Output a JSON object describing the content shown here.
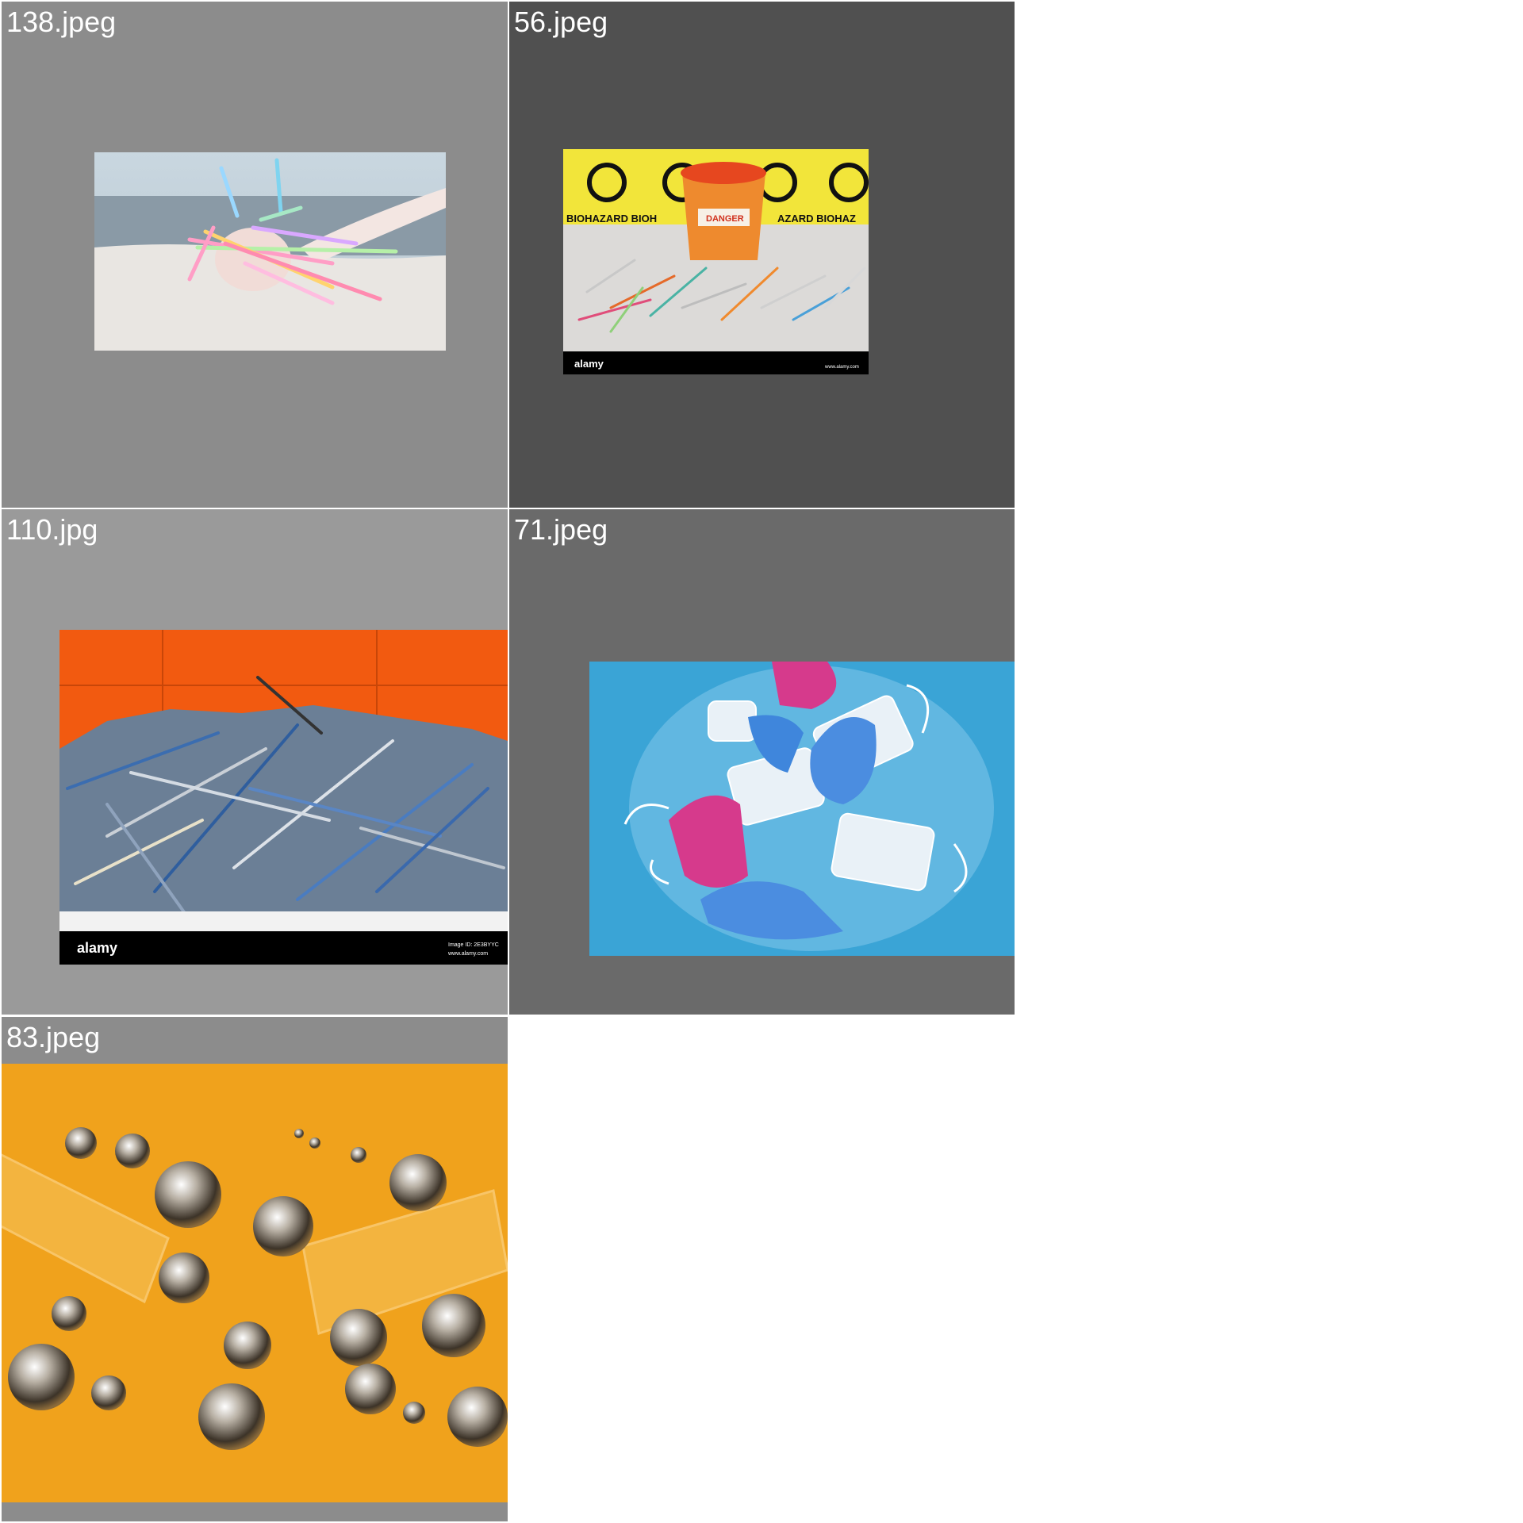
{
  "gallery": {
    "tiles": [
      {
        "filename": "138.jpeg",
        "subject": "hand holding plastic straws at beach",
        "background": "#8c8c8c"
      },
      {
        "filename": "56.jpeg",
        "subject": "biohazard sharps container with syringes",
        "background": "#505050",
        "overlay_text": [
          "BIOHAZARD BIOH",
          "AZARD BIOHAZ",
          "DANGER",
          "alamy",
          "www.alamy.com"
        ]
      },
      {
        "filename": "110.jpg",
        "subject": "pile of scrap metal strips against orange wall",
        "background": "#9a9a9a",
        "overlay_text": [
          "alamy",
          "Image ID: 2E3BYYC",
          "www.alamy.com"
        ]
      },
      {
        "filename": "71.jpeg",
        "subject": "used gloves and face masks in plastic bag",
        "background": "#6a6a6a"
      },
      {
        "filename": "83.jpeg",
        "subject": "mercury droplets and glass tubes on orange surface",
        "background": "#8c8c8c"
      }
    ]
  }
}
